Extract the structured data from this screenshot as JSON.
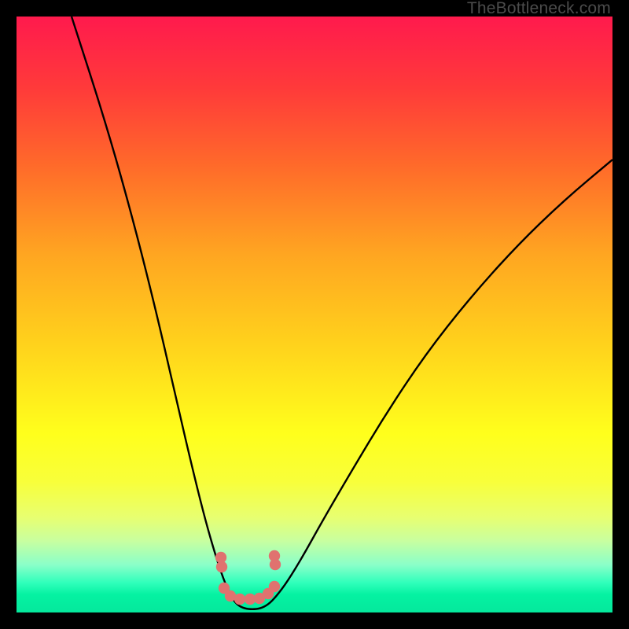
{
  "watermark": "TheBottleneck.com",
  "chart_data": {
    "type": "line",
    "title": "",
    "xlabel": "",
    "ylabel": "",
    "series": [
      {
        "name": "bottleneck-curve",
        "note": "Black V-shaped curve. Values are pixel coordinates in the 758x758 plot area (read directly from the image since no axes are labeled).",
        "points": [
          [
            70,
            0
          ],
          [
            115,
            140
          ],
          [
            150,
            265
          ],
          [
            180,
            385
          ],
          [
            205,
            495
          ],
          [
            225,
            580
          ],
          [
            240,
            640
          ],
          [
            253,
            685
          ],
          [
            263,
            715
          ],
          [
            272,
            736
          ],
          [
            280,
            748
          ],
          [
            290,
            753
          ],
          [
            300,
            754
          ],
          [
            310,
            753
          ],
          [
            320,
            748
          ],
          [
            330,
            738
          ],
          [
            345,
            718
          ],
          [
            365,
            685
          ],
          [
            390,
            640
          ],
          [
            425,
            580
          ],
          [
            470,
            505
          ],
          [
            520,
            430
          ],
          [
            575,
            360
          ],
          [
            635,
            293
          ],
          [
            695,
            235
          ],
          [
            758,
            182
          ]
        ]
      },
      {
        "name": "pink-dots",
        "note": "Scatter of pink-red dots near the curve trough (pixel coordinates).",
        "points": [
          [
            260,
            688
          ],
          [
            261,
            700
          ],
          [
            264,
            727
          ],
          [
            272,
            737
          ],
          [
            284,
            741
          ],
          [
            297,
            741
          ],
          [
            309,
            740
          ],
          [
            320,
            734
          ],
          [
            328,
            725
          ],
          [
            329,
            697
          ],
          [
            328,
            686
          ]
        ]
      }
    ],
    "colors": {
      "curve": "#000000",
      "dots": "#e0726f"
    }
  }
}
